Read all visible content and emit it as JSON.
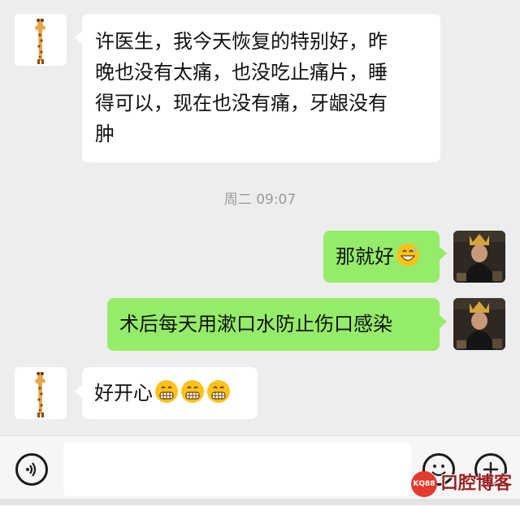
{
  "messages": [
    {
      "side": "left",
      "avatar": "giraffe-avatar",
      "lines": [
        "许医生，我今天恢复的特别好，昨",
        "晚也没有太痛，也没吃止痛片，睡",
        "得可以，现在也没有痛，牙龈没有",
        "肿"
      ]
    },
    {
      "type": "timestamp",
      "text": "周二 09:07"
    },
    {
      "side": "right",
      "avatar": "user-photo-avatar",
      "text": "那就好",
      "emoji": [
        "grinning-sweat-emoji"
      ]
    },
    {
      "side": "right",
      "avatar": "user-photo-avatar",
      "text": "术后每天用漱口水防止伤口感染"
    },
    {
      "side": "left",
      "avatar": "giraffe-avatar",
      "text": "好开心",
      "emoji": [
        "grimace-emoji",
        "grimace-emoji",
        "grimace-emoji"
      ]
    }
  ],
  "input_bar": {
    "voice_icon": "voice-icon",
    "emoji_icon": "smiley-icon",
    "plus_icon": "plus-icon",
    "input_value": ""
  },
  "watermark": {
    "logo_text": "KQ88",
    "text": "口腔博客"
  },
  "colors": {
    "background": "#ededed",
    "incoming_bubble": "#ffffff",
    "outgoing_bubble": "#95ec69"
  }
}
